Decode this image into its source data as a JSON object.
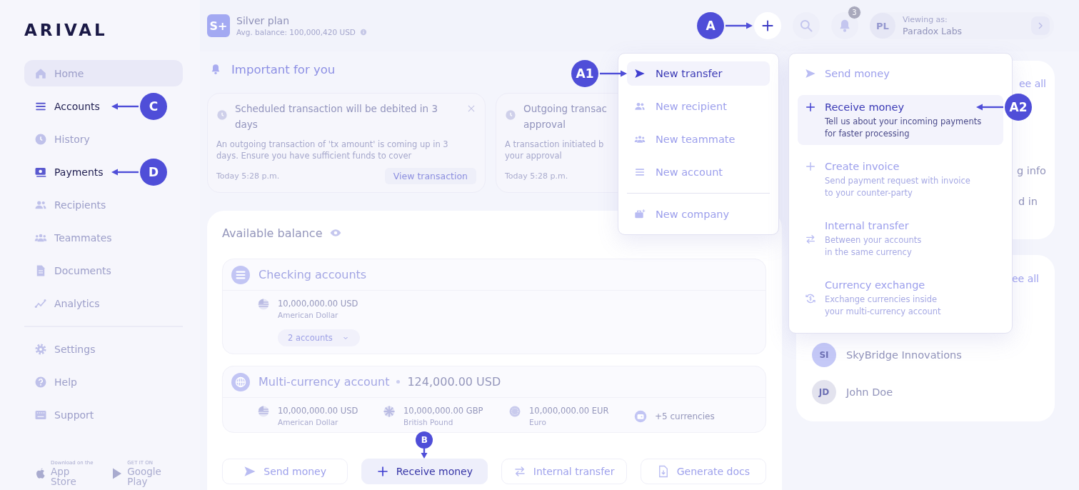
{
  "logo": "ARIVAL",
  "sidebar": {
    "items": [
      {
        "label": "Home",
        "selected": true,
        "highlighted": false
      },
      {
        "label": "Accounts",
        "selected": false,
        "highlighted": true,
        "callout": "C"
      },
      {
        "label": "History",
        "selected": false,
        "highlighted": false
      },
      {
        "label": "Payments",
        "selected": false,
        "highlighted": true,
        "callout": "D"
      },
      {
        "label": "Recipients",
        "selected": false,
        "highlighted": false
      },
      {
        "label": "Teammates",
        "selected": false,
        "highlighted": false
      },
      {
        "label": "Documents",
        "selected": false,
        "highlighted": false
      },
      {
        "label": "Analytics",
        "selected": false,
        "highlighted": false
      }
    ],
    "footer_items": [
      {
        "label": "Settings",
        "selected": false,
        "highlighted": false
      },
      {
        "label": "Help",
        "selected": false,
        "highlighted": false
      },
      {
        "label": "Support",
        "selected": false,
        "highlighted": false
      }
    ],
    "stores": [
      {
        "caption": "Download on the",
        "name": "App Store"
      },
      {
        "caption": "GET IT ON",
        "name": "Google Play"
      }
    ]
  },
  "topbar": {
    "plan": {
      "badge": "S+",
      "name": "Silver plan",
      "balance": "Avg. balance: 100,000,420 USD"
    },
    "add_callout": "A",
    "notifications": "3",
    "account": {
      "initials": "PL",
      "caption": "Viewing as:",
      "name": "Paradox Labs"
    }
  },
  "important": {
    "title": "Important for you",
    "cards": [
      {
        "title_lines": [
          "Scheduled transaction will be debited in 3",
          "days"
        ],
        "body_lines": [
          "An outgoing transaction of 'tx amount' is coming up in 3",
          "days. Ensure you have sufficient funds to cover"
        ],
        "time": "Today 5:28 p.m.",
        "action": "View transaction",
        "closable": true
      },
      {
        "title_lines": [
          "Outgoing transac",
          "approval"
        ],
        "body_lines": [
          "A transaction initiated b",
          "your approval"
        ],
        "time": "Today 5:28 p.m."
      }
    ]
  },
  "balance": {
    "title": "Available balance",
    "groups": [
      {
        "title": "Checking accounts",
        "currencies": [
          {
            "amount": "10,000,000.00 USD",
            "name": "American Dollar"
          }
        ],
        "accounts_chip": "2 accounts"
      },
      {
        "title": "Multi-currency account",
        "total": "124,000.00 USD",
        "currencies": [
          {
            "amount": "10,000,000.00 USD",
            "name": "American Dollar"
          },
          {
            "amount": "10,000,000.00 GBP",
            "name": "British Pound"
          },
          {
            "amount": "10,000,000.00 EUR",
            "name": "Euro"
          }
        ],
        "more": "+5 currencies"
      }
    ],
    "actions": [
      {
        "label": "Send money",
        "highlighted": false
      },
      {
        "label": "Receive money",
        "highlighted": true,
        "callout": "B"
      },
      {
        "label": "Internal transfer",
        "highlighted": false
      },
      {
        "label": "Generate docs",
        "highlighted": false
      }
    ]
  },
  "add_menu": {
    "items": [
      {
        "kind": "item",
        "label": "New transfer",
        "highlighted": true,
        "callout": "A1"
      },
      {
        "kind": "item",
        "label": "New recipient",
        "highlighted": false
      },
      {
        "kind": "item",
        "label": "New teammate",
        "highlighted": false
      },
      {
        "kind": "item",
        "label": "New account",
        "highlighted": false
      },
      {
        "kind": "divider"
      },
      {
        "kind": "item",
        "label": "New company",
        "highlighted": false
      }
    ]
  },
  "receive_menu": {
    "items": [
      {
        "label": "Send money",
        "highlighted": false
      },
      {
        "label": "Receive money",
        "description_lines": [
          "Tell us about your incoming payments",
          "for faster processing"
        ],
        "highlighted": true,
        "callout": "A2"
      },
      {
        "label": "Create invoice",
        "description_lines": [
          "Send payment request with invoice",
          "to your counter-party"
        ],
        "highlighted": false
      },
      {
        "label": "Internal transfer",
        "description_lines": [
          "Between your accounts",
          "in the same currency"
        ],
        "highlighted": false
      },
      {
        "label": "Currency exchange",
        "description_lines": [
          "Exchange currencies inside",
          "your multi-currency account"
        ],
        "highlighted": false
      }
    ]
  },
  "right_panel": {
    "info_card": {
      "link": "ee all",
      "fragments": [
        "g info",
        "d in"
      ]
    },
    "contacts_card": {
      "link": "ee all",
      "contacts": [
        {
          "initials": "SI",
          "name": "SkyBridge Innovations",
          "color": "#c5c9f7"
        },
        {
          "initials": "JD",
          "name": "John Doe",
          "color": "#e3e3ee"
        }
      ]
    }
  }
}
